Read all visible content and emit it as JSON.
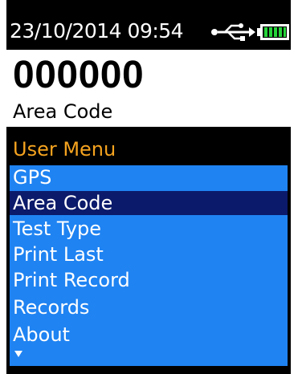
{
  "status_bar": {
    "datetime": "23/10/2014 09:54",
    "usb_icon": "usb-icon",
    "battery_icon": "battery-full-icon",
    "battery_color": "#26d43a"
  },
  "display": {
    "value": "000000",
    "label": "Area Code"
  },
  "menu": {
    "title": "User Menu",
    "title_color": "#f5a31f",
    "background_color": "#1f83f2",
    "selected_color": "#0b1a6a",
    "selected_index": 1,
    "items": [
      {
        "label": "GPS"
      },
      {
        "label": "Area Code"
      },
      {
        "label": "Test Type"
      },
      {
        "label": "Print Last"
      },
      {
        "label": "Print Record"
      },
      {
        "label": "Records"
      },
      {
        "label": "About"
      }
    ],
    "more_indicator": "scroll-down-arrow-icon"
  }
}
